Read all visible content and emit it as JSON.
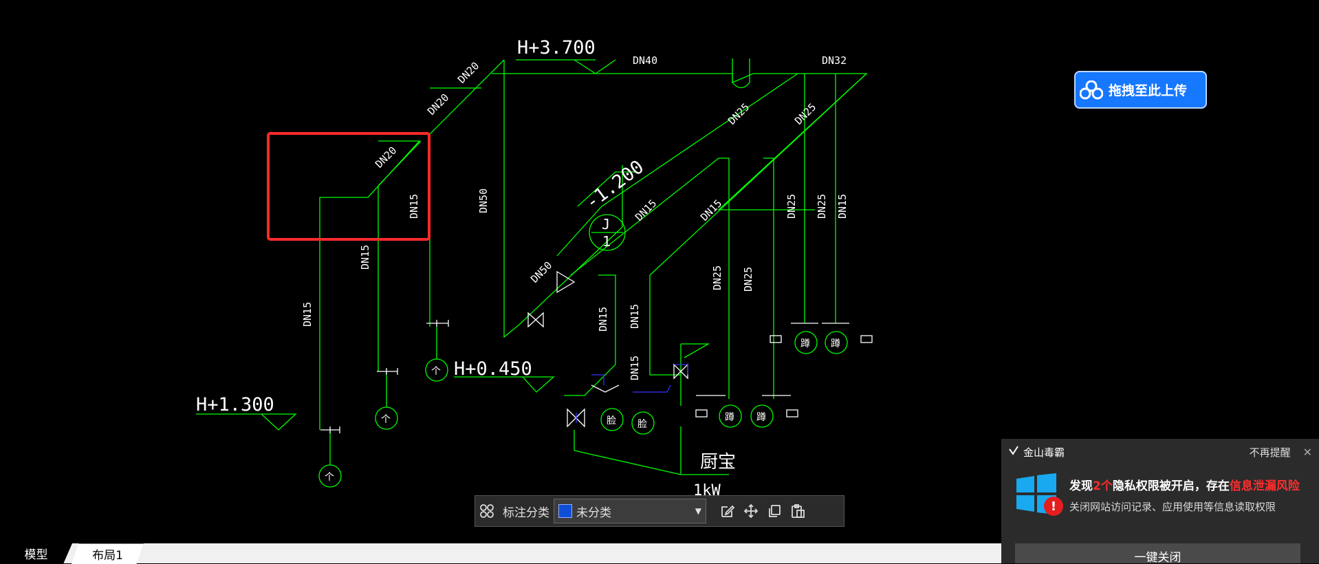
{
  "drawing": {
    "elevations": [
      "H+3.700",
      "-1.200",
      "H+0.450",
      "H+1.300"
    ],
    "pipe_labels": [
      "DN40",
      "DN32",
      "DN20",
      "DN20",
      "DN20",
      "DN15",
      "DN15",
      "DN15",
      "DN50",
      "DN50",
      "DN15",
      "DN15",
      "DN15",
      "DN15",
      "DN25",
      "DN25",
      "DN25",
      "DN25",
      "DN25",
      "DN25",
      "DN15",
      "DN15"
    ],
    "symbols": {
      "riser_letter": "J",
      "riser_number": "1",
      "faucet": "个",
      "basin": "脸",
      "squat": "蹲"
    },
    "room_label": "厨宝",
    "power_label": "1kW"
  },
  "upload_widget": {
    "label": "拖拽至此上传"
  },
  "annotation_toolbar": {
    "category_label": "标注分类",
    "category_value": "未分类",
    "category_color": "#0f4fd8"
  },
  "tabs": {
    "model": "模型",
    "layout1": "布局1"
  },
  "popup": {
    "brand": "金山毒霸",
    "dismiss": "不再提醒",
    "title_pre": "发现",
    "title_count": "2个",
    "title_mid": "隐私权限被开启，存在",
    "title_risk": "信息泄漏风险",
    "description": "关闭网站访问记录、应用使用等信息读取权限",
    "action": "一键关闭"
  }
}
